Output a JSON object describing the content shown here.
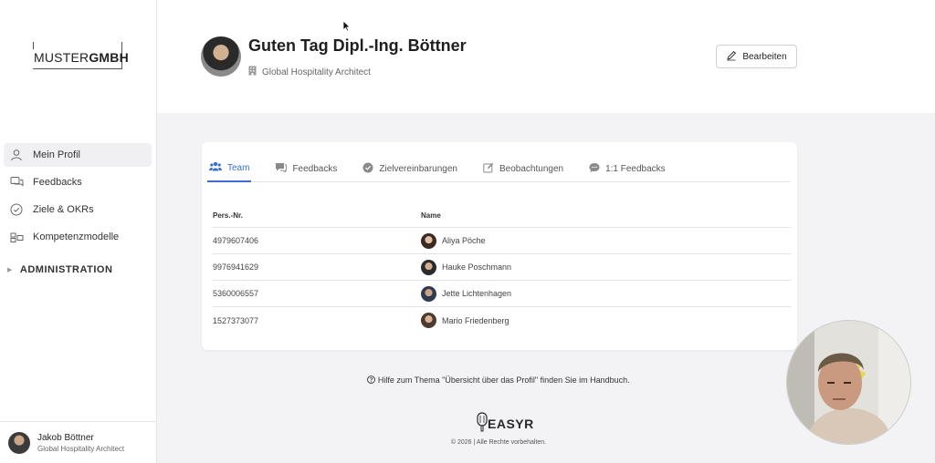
{
  "logo": {
    "part1": "MUSTER",
    "part2": "GMBH"
  },
  "nav": {
    "items": [
      {
        "label": "Mein Profil",
        "icon": "user-icon",
        "active": true
      },
      {
        "label": "Feedbacks",
        "icon": "chat-icon",
        "active": false
      },
      {
        "label": "Ziele & OKRs",
        "icon": "check-circle-icon",
        "active": false
      },
      {
        "label": "Kompetenzmodelle",
        "icon": "grid-icon",
        "active": false
      }
    ],
    "admin_label": "ADMINISTRATION"
  },
  "user": {
    "name": "Jakob Böttner",
    "role": "Global Hospitality Architect"
  },
  "header": {
    "greeting": "Guten Tag Dipl.-Ing. Böttner",
    "role": "Global Hospitality Architect",
    "edit_label": "Bearbeiten"
  },
  "tabs": [
    {
      "label": "Team",
      "icon": "team-icon",
      "active": true
    },
    {
      "label": "Feedbacks",
      "icon": "feedback-icon",
      "active": false
    },
    {
      "label": "Zielvereinbarungen",
      "icon": "check-circle-icon",
      "active": false
    },
    {
      "label": "Beobachtungen",
      "icon": "edit-note-icon",
      "active": false
    },
    {
      "label": "1:1 Feedbacks",
      "icon": "speech-bubble-icon",
      "active": false
    }
  ],
  "table": {
    "headers": [
      "Pers.-Nr.",
      "Name"
    ],
    "rows": [
      {
        "id": "4979607406",
        "name": "Aliya Pöche"
      },
      {
        "id": "9976941629",
        "name": "Hauke Poschmann"
      },
      {
        "id": "5360006557",
        "name": "Jette Lichtenhagen"
      },
      {
        "id": "1527373077",
        "name": "Mario Friedenberg"
      }
    ]
  },
  "footer": {
    "help": "Hilfe zum Thema \"Übersicht über das Profil\" finden Sie im Handbuch.",
    "brand": "EASYR",
    "copyright": "© 2026 | Alle Rechte vorbehalten."
  },
  "colors": {
    "accent": "#3a6fd1",
    "background": "#f3f3f5"
  }
}
